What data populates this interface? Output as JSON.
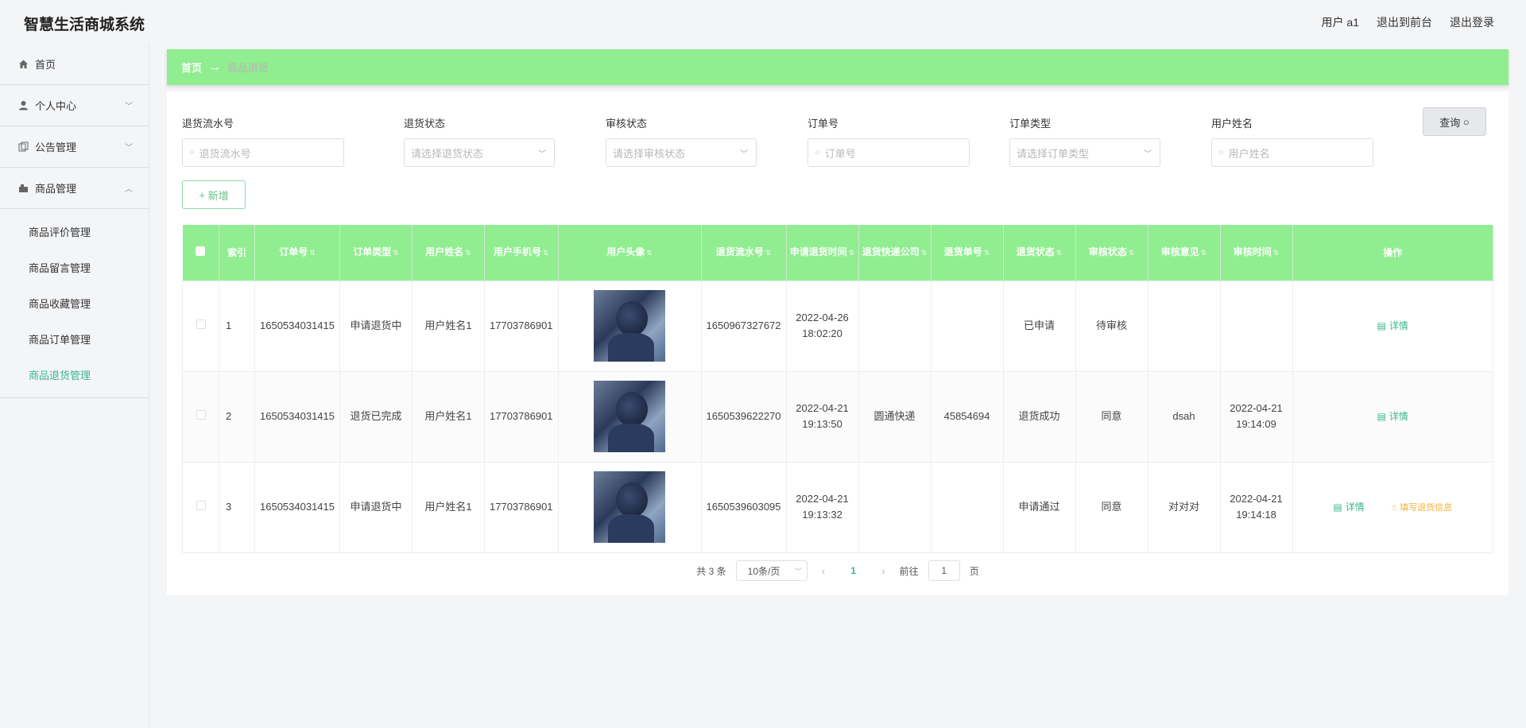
{
  "app": {
    "title": "智慧生活商城系统"
  },
  "top_links": [
    "用户 a1",
    "退出到前台",
    "退出登录"
  ],
  "sidebar": {
    "items": [
      {
        "label": "首页",
        "icon": "home-icon"
      },
      {
        "label": "个人中心",
        "icon": "user-icon"
      },
      {
        "label": "公告管理",
        "icon": "copy-icon"
      },
      {
        "label": "商品管理",
        "icon": "goods-icon"
      }
    ],
    "sub_items": [
      "商品评价管理",
      "商品留言管理",
      "商品收藏管理",
      "商品订单管理",
      "商品退货管理"
    ]
  },
  "breadcrumb": {
    "home": "首页",
    "arrow": "→",
    "current": "商品退货"
  },
  "filters": [
    {
      "label": "退货流水号",
      "placeholder": "退货流水号",
      "type": "input"
    },
    {
      "label": "退货状态",
      "placeholder": "请选择退货状态",
      "type": "select"
    },
    {
      "label": "审核状态",
      "placeholder": "请选择审核状态",
      "type": "select"
    },
    {
      "label": "订单号",
      "placeholder": "订单号",
      "type": "input"
    },
    {
      "label": "订单类型",
      "placeholder": "请选择订单类型",
      "type": "select"
    },
    {
      "label": "用户姓名",
      "placeholder": "用户姓名",
      "type": "input"
    }
  ],
  "buttons": {
    "query": "查询",
    "add": "新增"
  },
  "table": {
    "headers": [
      "索引",
      "订单号",
      "订单类型",
      "用户姓名",
      "用户手机号",
      "用户头像",
      "退货流水号",
      "申请退货时间",
      "退货快递公司",
      "退货单号",
      "退货状态",
      "审核状态",
      "审核意见",
      "审核时间",
      "操作"
    ],
    "rows": [
      {
        "index": "1",
        "order_no": "1650534031415",
        "order_type": "申请退货中",
        "user_name": "用户姓名1",
        "phone": "17703786901",
        "return_no": "1650967327672",
        "apply_time": "2022-04-26 18:02:20",
        "courier": "",
        "tracking_no": "",
        "return_status": "已申请",
        "audit_status": "待审核",
        "audit_opinion": "",
        "audit_time": "",
        "actions": [
          "详情"
        ]
      },
      {
        "index": "2",
        "order_no": "1650534031415",
        "order_type": "退货已完成",
        "user_name": "用户姓名1",
        "phone": "17703786901",
        "return_no": "1650539622270",
        "apply_time": "2022-04-21 19:13:50",
        "courier": "圆通快递",
        "tracking_no": "45854694",
        "return_status": "退货成功",
        "audit_status": "同意",
        "audit_opinion": "dsah",
        "audit_time": "2022-04-21 19:14:09",
        "actions": [
          "详情"
        ]
      },
      {
        "index": "3",
        "order_no": "1650534031415",
        "order_type": "申请退货中",
        "user_name": "用户姓名1",
        "phone": "17703786901",
        "return_no": "1650539603095",
        "apply_time": "2022-04-21 19:13:32",
        "courier": "",
        "tracking_no": "",
        "return_status": "申请通过",
        "audit_status": "同意",
        "audit_opinion": "对对对",
        "audit_time": "2022-04-21 19:14:18",
        "actions": [
          "详情",
          "填写退货信息"
        ]
      }
    ]
  },
  "pagination": {
    "total": "共 3 条",
    "page_size": "10条/页",
    "current": "1",
    "goto_label": "前往",
    "goto_value": "1",
    "page_suffix": "页"
  },
  "colors": {
    "accent": "#90ee90",
    "active": "#3bb58f",
    "warning": "#f0b13b"
  }
}
